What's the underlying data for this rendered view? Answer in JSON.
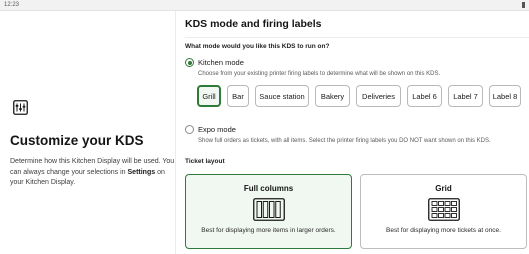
{
  "status_bar": {
    "time": "12:23"
  },
  "sidebar": {
    "title": "Customize your KDS",
    "description_part1": "Determine how this Kitchen Display will be used. You can always change your selections in ",
    "description_bold": "Settings",
    "description_part2": " on your Kitchen Display.",
    "icon": "kds-sliders-icon"
  },
  "main": {
    "heading": "KDS mode and firing labels",
    "question": "What mode would you like this KDS to run on?",
    "kitchen_mode": {
      "label": "Kitchen mode",
      "selected": true,
      "helper": "Choose from your existing printer firing labels to determine what will be shown on this KDS."
    },
    "labels": [
      {
        "text": "Grill",
        "selected": true
      },
      {
        "text": "Bar",
        "selected": false
      },
      {
        "text": "Sauce station",
        "selected": false
      },
      {
        "text": "Bakery",
        "selected": false
      },
      {
        "text": "Deliveries",
        "selected": false
      },
      {
        "text": "Label 6",
        "selected": false
      },
      {
        "text": "Label 7",
        "selected": false
      },
      {
        "text": "Label 8",
        "selected": false
      }
    ],
    "expo_mode": {
      "label": "Expo mode",
      "selected": false,
      "helper": "Show full orders as tickets, with all items. Select the printer firing labels you DO NOT want shown on this KDS."
    },
    "ticket_layout": {
      "label": "Ticket layout",
      "options": [
        {
          "title": "Full columns",
          "description": "Best for displaying more items in larger orders.",
          "selected": true,
          "icon": "columns-icon"
        },
        {
          "title": "Grid",
          "description": "Best for displaying more tickets at once.",
          "selected": false,
          "icon": "grid-icon"
        }
      ]
    }
  },
  "colors": {
    "accent": "#2d7a3a",
    "accent_bg": "#f1f8f2",
    "border": "#bdbdbd"
  }
}
